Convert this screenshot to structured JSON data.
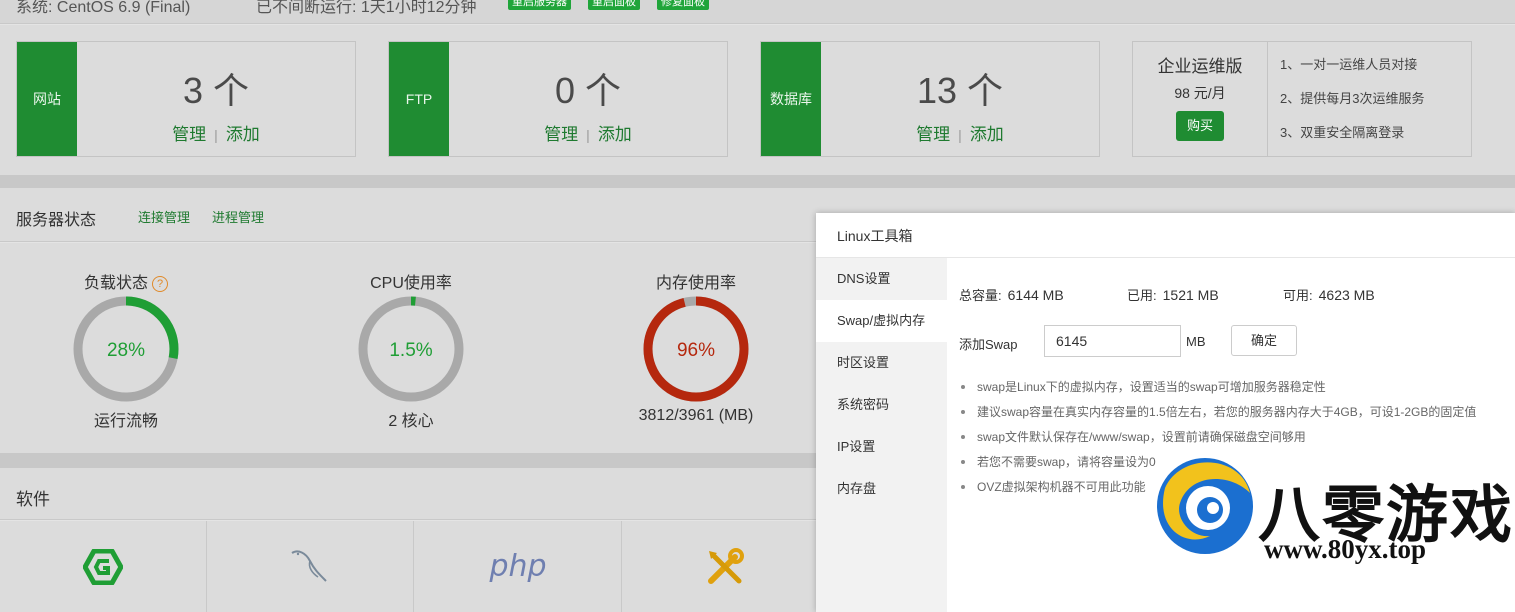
{
  "topbar": {
    "system": "系统: CentOS 6.9 (Final)",
    "uptime": "已不间断运行: 1天1小时12分钟",
    "buttons": [
      "重启服务器",
      "重启面板",
      "修复面板"
    ]
  },
  "cards": [
    {
      "tag": "网站",
      "count": "3 个",
      "manage": "管理",
      "add": "添加"
    },
    {
      "tag": "FTP",
      "count": "0 个",
      "manage": "管理",
      "add": "添加"
    },
    {
      "tag": "数据库",
      "count": "13 个",
      "manage": "管理",
      "add": "添加"
    }
  ],
  "promo": {
    "title": "企业运维版",
    "price": "98 元/月",
    "buy": "购买",
    "features": [
      "1、一对一运维人员对接",
      "2、提供每月3次运维服务",
      "3、双重安全隔离登录"
    ]
  },
  "status": {
    "title": "服务器状态",
    "links": [
      "连接管理",
      "进程管理"
    ],
    "gauges": [
      {
        "label": "负载状态",
        "value": "28%",
        "percent": 28,
        "sub": "运行流畅",
        "color": "#1f9e35"
      },
      {
        "label": "CPU使用率",
        "value": "1.5%",
        "percent": 1.5,
        "sub": "2 核心",
        "color": "#1f9e35"
      },
      {
        "label": "内存使用率",
        "value": "96%",
        "percent": 96,
        "sub": "3812/3961 (MB)",
        "color": "#b5280e"
      }
    ]
  },
  "software": {
    "title": "软件",
    "items": [
      "nginx-icon",
      "mysql-icon",
      "php-icon",
      "tools-icon"
    ]
  },
  "modal": {
    "title": "Linux工具箱",
    "menu": [
      "DNS设置",
      "Swap/虚拟内存",
      "时区设置",
      "系统密码",
      "IP设置",
      "内存盘"
    ],
    "active_index": 1,
    "stats": {
      "total_label": "总容量:",
      "total": "6144 MB",
      "used_label": "已用:",
      "used": "1521 MB",
      "free_label": "可用:",
      "free": "4623 MB"
    },
    "swap_label": "添加Swap",
    "swap_value": "6145",
    "swap_unit": "MB",
    "confirm": "确定",
    "tips": [
      "swap是Linux下的虚拟内存，设置适当的swap可增加服务器稳定性",
      "建议swap容量在真实内存容量的1.5倍左右，若您的服务器内存大于4GB，可设1-2GB的固定值",
      "swap文件默认保存在/www/swap，设置前请确保磁盘空间够用",
      "若您不需要swap，请将容量设为0",
      "OVZ虚拟架构机器不可用此功能"
    ]
  },
  "watermark": {
    "name": "八零游戏",
    "url": "www.80yx.top"
  }
}
